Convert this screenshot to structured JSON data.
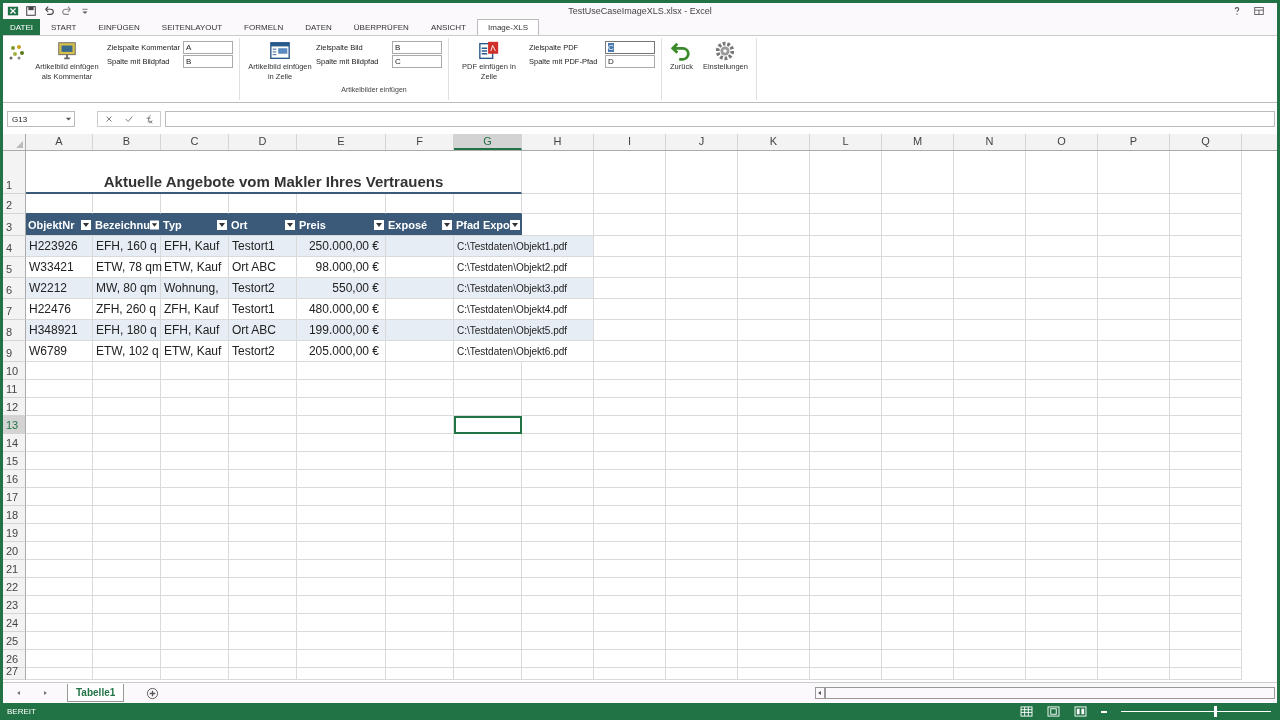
{
  "window": {
    "title": "TestUseCaseImageXLS.xlsx - Excel"
  },
  "ribbon_tabs": [
    {
      "label": "DATEI",
      "selected": false,
      "kind": "file"
    },
    {
      "label": "START",
      "selected": false,
      "kind": "tab"
    },
    {
      "label": "EINFÜGEN",
      "selected": false,
      "kind": "tab"
    },
    {
      "label": "SEITENLAYOUT",
      "selected": false,
      "kind": "tab"
    },
    {
      "label": "FORMELN",
      "selected": false,
      "kind": "tab"
    },
    {
      "label": "DATEN",
      "selected": false,
      "kind": "tab"
    },
    {
      "label": "ÜBERPRÜFEN",
      "selected": false,
      "kind": "tab"
    },
    {
      "label": "ANSICHT",
      "selected": false,
      "kind": "tab"
    },
    {
      "label": "Image-XLS",
      "selected": true,
      "kind": "tab"
    }
  ],
  "ribbon": {
    "comment_button": "Artikelbild einfügen als Kommentar",
    "comment_fields": [
      {
        "label": "Zielspalte Kommentar",
        "value": "A",
        "focused": false
      },
      {
        "label": "Spalte mit Bildpfad",
        "value": "B",
        "focused": false
      }
    ],
    "cell_button": "Artikelbild einfügen in Zelle",
    "cell_fields": [
      {
        "label": "Zielspalte Bild",
        "value": "B",
        "focused": false
      },
      {
        "label": "Spalte mit Bildpfad",
        "value": "C",
        "focused": false
      }
    ],
    "group_label": "Artikelbilder einfügen",
    "pdf_button": "PDF einfügen in Zelle",
    "pdf_fields": [
      {
        "label": "Zielspalte PDF",
        "value": "C",
        "focused": true
      },
      {
        "label": "Spalte mit PDF-Pfad",
        "value": "D",
        "focused": false
      }
    ],
    "back_button": "Zurück",
    "settings_button": "Einstellungen"
  },
  "name_box": "G13",
  "columns": [
    {
      "label": "A",
      "selected": false
    },
    {
      "label": "B",
      "selected": false
    },
    {
      "label": "C",
      "selected": false
    },
    {
      "label": "D",
      "selected": false
    },
    {
      "label": "E",
      "selected": false
    },
    {
      "label": "F",
      "selected": false
    },
    {
      "label": "G",
      "selected": true
    },
    {
      "label": "H",
      "selected": false
    },
    {
      "label": "I",
      "selected": false
    },
    {
      "label": "J",
      "selected": false
    },
    {
      "label": "K",
      "selected": false
    },
    {
      "label": "L",
      "selected": false
    },
    {
      "label": "M",
      "selected": false
    },
    {
      "label": "N",
      "selected": false
    },
    {
      "label": "O",
      "selected": false
    },
    {
      "label": "P",
      "selected": false
    },
    {
      "label": "Q",
      "selected": false
    }
  ],
  "row_headers": [
    {
      "label": "1",
      "selected": false
    },
    {
      "label": "2",
      "selected": false
    },
    {
      "label": "3",
      "selected": false
    },
    {
      "label": "4",
      "selected": false
    },
    {
      "label": "5",
      "selected": false
    },
    {
      "label": "6",
      "selected": false
    },
    {
      "label": "7",
      "selected": false
    },
    {
      "label": "8",
      "selected": false
    },
    {
      "label": "9",
      "selected": false
    },
    {
      "label": "10",
      "selected": false
    },
    {
      "label": "11",
      "selected": false
    },
    {
      "label": "12",
      "selected": false
    },
    {
      "label": "13",
      "selected": true
    },
    {
      "label": "14",
      "selected": false
    },
    {
      "label": "15",
      "selected": false
    },
    {
      "label": "16",
      "selected": false
    },
    {
      "label": "17",
      "selected": false
    },
    {
      "label": "18",
      "selected": false
    },
    {
      "label": "19",
      "selected": false
    },
    {
      "label": "20",
      "selected": false
    },
    {
      "label": "21",
      "selected": false
    },
    {
      "label": "22",
      "selected": false
    },
    {
      "label": "23",
      "selected": false
    },
    {
      "label": "24",
      "selected": false
    },
    {
      "label": "25",
      "selected": false
    },
    {
      "label": "26",
      "selected": false
    },
    {
      "label": "27",
      "selected": false
    }
  ],
  "sheet_title": "Aktuelle Angebote vom Makler Ihres Vertrauens",
  "table": {
    "headers": [
      "ObjektNr",
      "Bezeichnu",
      "Typ",
      "Ort",
      "Preis",
      "Exposé",
      "Pfad Expo"
    ],
    "rows": [
      {
        "objekt": "H223926",
        "bezeichnung": "EFH, 160 q",
        "typ": "EFH, Kauf",
        "ort": "Testort1",
        "preis": "250.000,00 €",
        "pfad": "C:\\Testdaten\\Objekt1.pdf"
      },
      {
        "objekt": "W33421",
        "bezeichnung": "ETW, 78 qm",
        "typ": "ETW, Kauf",
        "ort": "Ort ABC",
        "preis": "98.000,00 €",
        "pfad": "C:\\Testdaten\\Objekt2.pdf"
      },
      {
        "objekt": "W2212",
        "bezeichnung": "MW, 80 qm",
        "typ": "Wohnung,",
        "ort": "Testort2",
        "preis": "550,00 €",
        "pfad": "C:\\Testdaten\\Objekt3.pdf"
      },
      {
        "objekt": "H22476",
        "bezeichnung": "ZFH, 260 q",
        "typ": "ZFH, Kauf",
        "ort": "Testort1",
        "preis": "480.000,00 €",
        "pfad": "C:\\Testdaten\\Objekt4.pdf"
      },
      {
        "objekt": "H348921",
        "bezeichnung": "EFH, 180 q",
        "typ": "EFH, Kauf",
        "ort": "Ort ABC",
        "preis": "199.000,00 €",
        "pfad": "C:\\Testdaten\\Objekt5.pdf"
      },
      {
        "objekt": "W6789",
        "bezeichnung": "ETW, 102 q",
        "typ": "ETW, Kauf",
        "ort": "Testort2",
        "preis": "205.000,00 €",
        "pfad": "C:\\Testdaten\\Objekt6.pdf"
      }
    ]
  },
  "sheet_tabs": [
    {
      "label": "Tabelle1",
      "selected": true
    }
  ],
  "status_bar": {
    "text": "BEREIT",
    "zoom": {
      "level": 0.62
    }
  }
}
